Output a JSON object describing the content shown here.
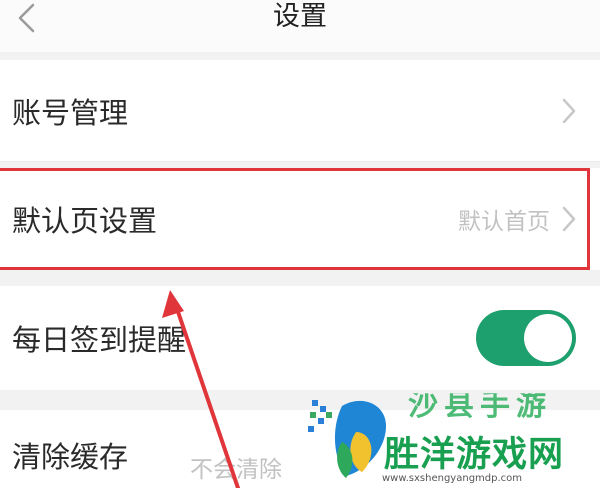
{
  "header": {
    "title": "设置"
  },
  "rows": {
    "account": {
      "label": "账号管理"
    },
    "default_page": {
      "label": "默认页设置",
      "value": "默认首页"
    },
    "checkin": {
      "label": "每日签到提醒",
      "toggle_on": true
    },
    "cache": {
      "label": "清除缓存",
      "value": "不会清除"
    }
  },
  "watermark": {
    "brand_top": "沙县手游",
    "brand": "胜洋游戏网",
    "url": "www.sxshengyangmdp.com"
  },
  "colors": {
    "accent_toggle": "#1e9f6e",
    "highlight": "#e0353a",
    "watermark_green": "#18a050"
  }
}
